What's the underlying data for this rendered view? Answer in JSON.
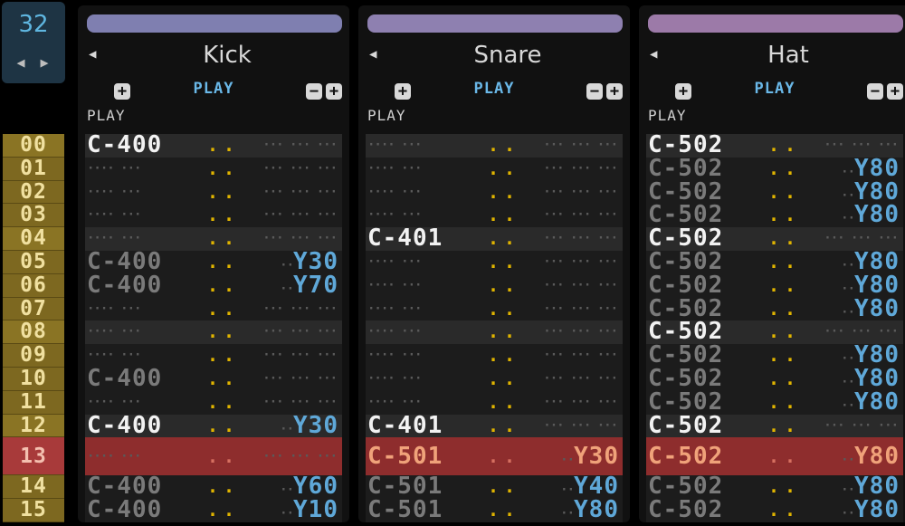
{
  "bpm": {
    "value": "32",
    "left_arrow": "◀",
    "right_arrow": "▶"
  },
  "row_numbers": [
    "00",
    "01",
    "02",
    "03",
    "04",
    "05",
    "06",
    "07",
    "08",
    "09",
    "10",
    "11",
    "12",
    "13",
    "14",
    "15"
  ],
  "current_row": 13,
  "tracks": [
    {
      "name": "Kick",
      "color": "#7f7fb0",
      "play_center": "PLAY",
      "play_left": "PLAY",
      "prev_arrow": "◀",
      "plus": "+",
      "minus": "−",
      "rows": [
        {
          "note": "C-400",
          "vel": "..",
          "fx": ""
        },
        {
          "note": "",
          "vel": "..",
          "fx": ""
        },
        {
          "note": "",
          "vel": "..",
          "fx": ""
        },
        {
          "note": "",
          "vel": "..",
          "fx": ""
        },
        {
          "note": "",
          "vel": "..",
          "fx": ""
        },
        {
          "note": "C-400",
          "ghost": true,
          "vel": "..",
          "fx": "Y30"
        },
        {
          "note": "C-400",
          "ghost": true,
          "vel": "..",
          "fx": "Y70"
        },
        {
          "note": "",
          "vel": "..",
          "fx": ""
        },
        {
          "note": "",
          "vel": "..",
          "fx": ""
        },
        {
          "note": "",
          "vel": "..",
          "fx": ""
        },
        {
          "note": "C-400",
          "ghost": true,
          "vel": "..",
          "fx": ""
        },
        {
          "note": "",
          "vel": "..",
          "fx": ""
        },
        {
          "note": "C-400",
          "vel": "..",
          "fx": "Y30"
        },
        {
          "note": "",
          "vel": "..",
          "fx": ""
        },
        {
          "note": "C-400",
          "ghost": true,
          "vel": "..",
          "fx": "Y60"
        },
        {
          "note": "C-400",
          "ghost": true,
          "vel": "..",
          "fx": "Y10"
        }
      ]
    },
    {
      "name": "Snare",
      "color": "#8e80b0",
      "play_center": "PLAY",
      "play_left": "PLAY",
      "prev_arrow": "◀",
      "plus": "+",
      "minus": "−",
      "rows": [
        {
          "note": "",
          "vel": "..",
          "fx": ""
        },
        {
          "note": "",
          "vel": "..",
          "fx": ""
        },
        {
          "note": "",
          "vel": "..",
          "fx": ""
        },
        {
          "note": "",
          "vel": "..",
          "fx": ""
        },
        {
          "note": "C-401",
          "vel": "..",
          "fx": ""
        },
        {
          "note": "",
          "vel": "..",
          "fx": ""
        },
        {
          "note": "",
          "vel": "..",
          "fx": ""
        },
        {
          "note": "",
          "vel": "..",
          "fx": ""
        },
        {
          "note": "",
          "vel": "..",
          "fx": ""
        },
        {
          "note": "",
          "vel": "..",
          "fx": ""
        },
        {
          "note": "",
          "vel": "..",
          "fx": ""
        },
        {
          "note": "",
          "vel": "..",
          "fx": ""
        },
        {
          "note": "C-401",
          "vel": "..",
          "fx": ""
        },
        {
          "note": "C-501",
          "vel": "..",
          "fx": "Y30"
        },
        {
          "note": "C-501",
          "ghost": true,
          "vel": "..",
          "fx": "Y40"
        },
        {
          "note": "C-501",
          "ghost": true,
          "vel": "..",
          "fx": "Y80"
        }
      ]
    },
    {
      "name": "Hat",
      "color": "#9c7aa8",
      "play_center": "PLAY",
      "play_left": "PLAY",
      "prev_arrow": "◀",
      "plus": "+",
      "minus": "−",
      "rows": [
        {
          "note": "C-502",
          "vel": "..",
          "fx": ""
        },
        {
          "note": "C-502",
          "ghost": true,
          "vel": "..",
          "fx": "Y80"
        },
        {
          "note": "C-502",
          "ghost": true,
          "vel": "..",
          "fx": "Y80"
        },
        {
          "note": "C-502",
          "ghost": true,
          "vel": "..",
          "fx": "Y80"
        },
        {
          "note": "C-502",
          "vel": "..",
          "fx": ""
        },
        {
          "note": "C-502",
          "ghost": true,
          "vel": "..",
          "fx": "Y80"
        },
        {
          "note": "C-502",
          "ghost": true,
          "vel": "..",
          "fx": "Y80"
        },
        {
          "note": "C-502",
          "ghost": true,
          "vel": "..",
          "fx": "Y80"
        },
        {
          "note": "C-502",
          "vel": "..",
          "fx": ""
        },
        {
          "note": "C-502",
          "ghost": true,
          "vel": "..",
          "fx": "Y80"
        },
        {
          "note": "C-502",
          "ghost": true,
          "vel": "..",
          "fx": "Y80"
        },
        {
          "note": "C-502",
          "ghost": true,
          "vel": "..",
          "fx": "Y80"
        },
        {
          "note": "C-502",
          "vel": "..",
          "fx": ""
        },
        {
          "note": "C-502",
          "vel": "..",
          "fx": "Y80"
        },
        {
          "note": "C-502",
          "ghost": true,
          "vel": "..",
          "fx": "Y80"
        },
        {
          "note": "C-502",
          "ghost": true,
          "vel": "..",
          "fx": "Y80"
        }
      ]
    }
  ],
  "empty_glyph": "···· ···",
  "fx_empty_glyph": "··· ··· ···",
  "fx_prefix": "··"
}
